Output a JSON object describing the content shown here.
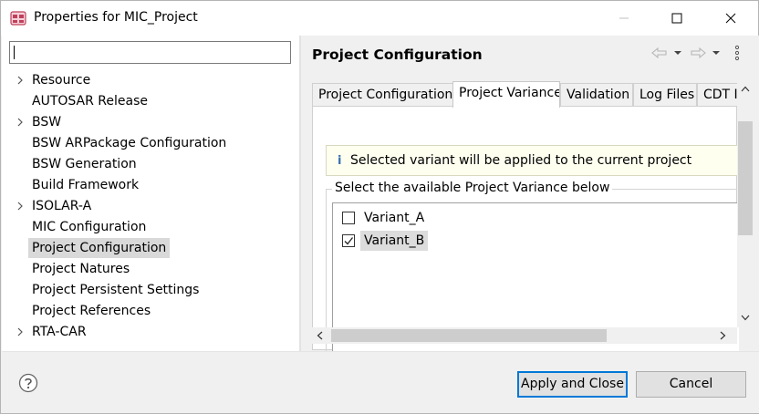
{
  "window": {
    "title": "Properties for MIC_Project"
  },
  "filter": {
    "value": "",
    "placeholder": ""
  },
  "tree": {
    "items": [
      {
        "label": "Resource",
        "expandable": true,
        "selected": false
      },
      {
        "label": "AUTOSAR Release",
        "expandable": false,
        "selected": false
      },
      {
        "label": "BSW",
        "expandable": true,
        "selected": false
      },
      {
        "label": "BSW ARPackage Configuration",
        "expandable": false,
        "selected": false
      },
      {
        "label": "BSW Generation",
        "expandable": false,
        "selected": false
      },
      {
        "label": "Build Framework",
        "expandable": false,
        "selected": false
      },
      {
        "label": "ISOLAR-A",
        "expandable": true,
        "selected": false
      },
      {
        "label": "MIC Configuration",
        "expandable": false,
        "selected": false
      },
      {
        "label": "Project Configuration",
        "expandable": false,
        "selected": true
      },
      {
        "label": "Project Natures",
        "expandable": false,
        "selected": false
      },
      {
        "label": "Project Persistent Settings",
        "expandable": false,
        "selected": false
      },
      {
        "label": "Project References",
        "expandable": false,
        "selected": false
      },
      {
        "label": "RTA-CAR",
        "expandable": true,
        "selected": false
      }
    ]
  },
  "page": {
    "title": "Project Configuration"
  },
  "tabs": [
    {
      "label": "Project Configuration",
      "active": false
    },
    {
      "label": "Project Variance",
      "active": true
    },
    {
      "label": "Validation",
      "active": false
    },
    {
      "label": "Log Files",
      "active": false
    },
    {
      "label": "CDT I",
      "active": false
    }
  ],
  "info": {
    "icon": "info-icon",
    "text": "Selected variant will be applied to the current project"
  },
  "variance": {
    "group_label": "Select the available Project Variance below",
    "variants": [
      {
        "label": "Variant_A",
        "checked": false,
        "selected": false
      },
      {
        "label": "Variant_B",
        "checked": true,
        "selected": true
      }
    ]
  },
  "footer": {
    "apply_label": "Apply and Close",
    "cancel_label": "Cancel"
  },
  "colors": {
    "accent": "#0078d7",
    "selection": "#d9d9d9",
    "info_background": "#fffff0"
  }
}
